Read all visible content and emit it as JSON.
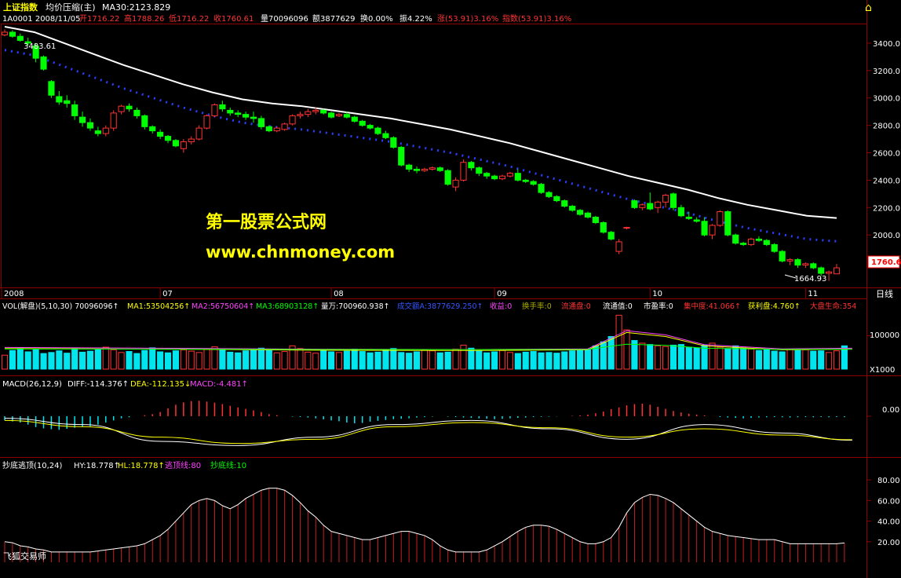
{
  "header": {
    "index_name": "上证指数",
    "main_indicator": "均价压缩(主)",
    "ma30": "MA30:2123.829",
    "quote_code_date": "1A0001 2008/11/05",
    "open": "开1716.22",
    "high": "高1788.26",
    "low": "低1716.22",
    "close": "收1760.61",
    "volume": "量70096096",
    "amount": "额3877629",
    "turnover": "换0.00%",
    "amplitude": "振4.22%",
    "change": "涨(53.91)3.16%",
    "index_change": "指数(53.91)3.16%"
  },
  "watermark": {
    "line1": "第一股票公式网",
    "line2": "www.chnmoney.com"
  },
  "annotations": {
    "high_label": "3483.61",
    "low_label": "1664.93",
    "current_price": "1760.6",
    "period": "日线"
  },
  "volume_panel": {
    "title": "VOL(解盘)(5,10,30) 70096096↑",
    "ma1": "MA1:53504256↑",
    "ma2": "MA2:56750604↑",
    "ma3": "MA3:68903128↑",
    "wan": "量万:700960.938↑",
    "amount": "成交额A:3877629.250↑",
    "yield": "收益:0",
    "turnover": "换手率:0",
    "float_shares": "流通盘:0",
    "float_value": "流通值:0",
    "pe": "市盈率:0",
    "concentration": "集中度:41.066↑",
    "profit": "获利盘:4.760↑",
    "life": "大盘生命:354",
    "axis_label": "100000",
    "unit": "X1000"
  },
  "macd_panel": {
    "title": "MACD(26,12,9)",
    "diff": "DIFF:-114.376↑",
    "dea": "DEA:-112.135↓",
    "macd": "MACD:-4.481↑",
    "axis_label": "0.00"
  },
  "bottom_panel": {
    "title": "抄底逃顶(10,24)",
    "hy": "HY:18.778↑",
    "hl": "HL:18.778↑",
    "escape": "逃顶线:80",
    "bottom": "抄底线:10",
    "brand": "飞狐交易师"
  },
  "chart_data": {
    "type": "candlestick",
    "x_ticks": [
      "2008",
      "07",
      "08",
      "09",
      "10",
      "11"
    ],
    "y_ticks": [
      3400,
      3200,
      3000,
      2800,
      2600,
      2400,
      2200,
      2000
    ],
    "ylim": [
      1640,
      3520
    ],
    "colors": {
      "up": "#ff3333",
      "down": "#00ff00",
      "ma30": "#ffffff",
      "band": "#2b3dff",
      "axis": "#8b0000"
    },
    "candles": [
      [
        3460,
        3500,
        3450,
        3480
      ],
      [
        3480,
        3495,
        3440,
        3450
      ],
      [
        3450,
        3470,
        3410,
        3420
      ],
      [
        3410,
        3440,
        3380,
        3400
      ],
      [
        3380,
        3400,
        3260,
        3290
      ],
      [
        3300,
        3310,
        3200,
        3210
      ],
      [
        3120,
        3130,
        3000,
        3020
      ],
      [
        3010,
        3050,
        2950,
        2970
      ],
      [
        2980,
        3020,
        2930,
        2960
      ],
      [
        2950,
        2980,
        2840,
        2870
      ],
      [
        2860,
        2900,
        2790,
        2820
      ],
      [
        2820,
        2850,
        2760,
        2780
      ],
      [
        2760,
        2790,
        2720,
        2740
      ],
      [
        2740,
        2800,
        2720,
        2780
      ],
      [
        2780,
        2910,
        2760,
        2890
      ],
      [
        2900,
        2950,
        2880,
        2940
      ],
      [
        2940,
        2960,
        2900,
        2920
      ],
      [
        2910,
        2930,
        2850,
        2870
      ],
      [
        2870,
        2880,
        2770,
        2790
      ],
      [
        2790,
        2800,
        2740,
        2760
      ],
      [
        2750,
        2770,
        2700,
        2720
      ],
      [
        2720,
        2730,
        2670,
        2690
      ],
      [
        2690,
        2700,
        2640,
        2650
      ],
      [
        2630,
        2700,
        2600,
        2680
      ],
      [
        2680,
        2720,
        2660,
        2700
      ],
      [
        2700,
        2800,
        2690,
        2780
      ],
      [
        2780,
        2880,
        2770,
        2870
      ],
      [
        2870,
        2960,
        2860,
        2950
      ],
      [
        2950,
        2980,
        2900,
        2920
      ],
      [
        2910,
        2930,
        2870,
        2890
      ],
      [
        2890,
        2910,
        2860,
        2880
      ],
      [
        2880,
        2900,
        2840,
        2860
      ],
      [
        2860,
        2900,
        2820,
        2850
      ],
      [
        2850,
        2870,
        2770,
        2790
      ],
      [
        2790,
        2800,
        2750,
        2760
      ],
      [
        2760,
        2790,
        2750,
        2780
      ],
      [
        2770,
        2820,
        2760,
        2810
      ],
      [
        2810,
        2880,
        2800,
        2870
      ],
      [
        2870,
        2900,
        2850,
        2880
      ],
      [
        2880,
        2920,
        2860,
        2900
      ],
      [
        2900,
        2930,
        2880,
        2910
      ],
      [
        2910,
        2920,
        2880,
        2890
      ],
      [
        2890,
        2900,
        2850,
        2860
      ],
      [
        2870,
        2890,
        2860,
        2880
      ],
      [
        2880,
        2900,
        2850,
        2860
      ],
      [
        2860,
        2870,
        2820,
        2830
      ],
      [
        2830,
        2840,
        2790,
        2800
      ],
      [
        2800,
        2810,
        2770,
        2780
      ],
      [
        2780,
        2790,
        2730,
        2740
      ],
      [
        2740,
        2760,
        2700,
        2710
      ],
      [
        2710,
        2720,
        2630,
        2640
      ],
      [
        2640,
        2650,
        2500,
        2510
      ],
      [
        2510,
        2520,
        2460,
        2480
      ],
      [
        2480,
        2500,
        2450,
        2470
      ],
      [
        2470,
        2490,
        2460,
        2480
      ],
      [
        2480,
        2500,
        2470,
        2490
      ],
      [
        2490,
        2500,
        2460,
        2470
      ],
      [
        2470,
        2480,
        2360,
        2370
      ],
      [
        2350,
        2420,
        2320,
        2400
      ],
      [
        2400,
        2550,
        2390,
        2530
      ],
      [
        2530,
        2540,
        2470,
        2490
      ],
      [
        2490,
        2500,
        2430,
        2450
      ],
      [
        2450,
        2460,
        2410,
        2430
      ],
      [
        2430,
        2440,
        2400,
        2410
      ],
      [
        2410,
        2440,
        2400,
        2430
      ],
      [
        2430,
        2460,
        2420,
        2450
      ],
      [
        2450,
        2480,
        2390,
        2400
      ],
      [
        2400,
        2410,
        2380,
        2390
      ],
      [
        2390,
        2400,
        2360,
        2370
      ],
      [
        2370,
        2380,
        2300,
        2310
      ],
      [
        2310,
        2320,
        2270,
        2280
      ],
      [
        2280,
        2290,
        2240,
        2250
      ],
      [
        2250,
        2260,
        2200,
        2210
      ],
      [
        2210,
        2220,
        2170,
        2180
      ],
      [
        2180,
        2190,
        2140,
        2150
      ],
      [
        2160,
        2170,
        2120,
        2130
      ],
      [
        2130,
        2140,
        2080,
        2090
      ],
      [
        2090,
        2100,
        2010,
        2020
      ],
      [
        2020,
        2030,
        1960,
        1970
      ],
      [
        1880,
        1970,
        1860,
        1950
      ],
      [
        2050,
        2060,
        2040,
        2055
      ],
      [
        2250,
        2260,
        2190,
        2200
      ],
      [
        2200,
        2230,
        2180,
        2220
      ],
      [
        2230,
        2310,
        2180,
        2190
      ],
      [
        2200,
        2250,
        2160,
        2240
      ],
      [
        2240,
        2300,
        2200,
        2290
      ],
      [
        2300,
        2310,
        2180,
        2200
      ],
      [
        2200,
        2220,
        2130,
        2140
      ],
      [
        2130,
        2170,
        2110,
        2120
      ],
      [
        2110,
        2130,
        2090,
        2100
      ],
      [
        2100,
        2130,
        1990,
        2000
      ],
      [
        2000,
        2080,
        1970,
        2070
      ],
      [
        2070,
        2180,
        2060,
        2170
      ],
      [
        2170,
        2180,
        1990,
        2000
      ],
      [
        2000,
        2010,
        1930,
        1940
      ],
      [
        1940,
        1950,
        1920,
        1930
      ],
      [
        1930,
        1980,
        1920,
        1970
      ],
      [
        1970,
        1990,
        1950,
        1960
      ],
      [
        1960,
        1970,
        1920,
        1930
      ],
      [
        1930,
        1940,
        1870,
        1880
      ],
      [
        1880,
        1890,
        1800,
        1810
      ],
      [
        1810,
        1830,
        1780,
        1820
      ],
      [
        1820,
        1830,
        1760,
        1780
      ],
      [
        1780,
        1800,
        1760,
        1790
      ],
      [
        1790,
        1800,
        1750,
        1760
      ],
      [
        1760,
        1770,
        1700,
        1720
      ],
      [
        1720,
        1740,
        1665,
        1730
      ],
      [
        1716,
        1788,
        1716,
        1760
      ]
    ],
    "ma30_values": [
      3520,
      3480,
      3400,
      3320,
      3240,
      3170,
      3100,
      3040,
      2990,
      2960,
      2940,
      2910,
      2880,
      2850,
      2810,
      2770,
      2720,
      2670,
      2610,
      2550,
      2490,
      2430,
      2380,
      2330,
      2270,
      2220,
      2180,
      2140,
      2123.829
    ],
    "ma30_range": [
      0,
      29
    ],
    "volume_unit": "X1000",
    "volume_ylim": [
      0,
      170000
    ],
    "volume_values": [
      42000,
      56000,
      62000,
      52000,
      58000,
      47000,
      50000,
      55000,
      48000,
      62000,
      51000,
      54000,
      60000,
      66000,
      58000,
      50000,
      53000,
      47000,
      56000,
      64000,
      52000,
      49000,
      55000,
      58000,
      54000,
      50000,
      61000,
      67000,
      58000,
      51000,
      49000,
      55000,
      60000,
      63000,
      57000,
      49000,
      53000,
      70000,
      62000,
      51000,
      48000,
      56000,
      52000,
      50000,
      54000,
      60000,
      53000,
      49000,
      51000,
      57000,
      62000,
      50000,
      48000,
      52000,
      58000,
      55000,
      49000,
      51000,
      60000,
      72000,
      63000,
      54000,
      49000,
      52000,
      56000,
      50000,
      47000,
      51000,
      53000,
      49000,
      50000,
      48000,
      52000,
      55000,
      60000,
      58000,
      70000,
      82000,
      98000,
      162000,
      118000,
      86000,
      78000,
      74000,
      70000,
      68000,
      72000,
      74000,
      66000,
      64000,
      72000,
      78000,
      66000,
      62000,
      70000,
      64000,
      60000,
      56000,
      58000,
      54000,
      52000,
      60000,
      56000,
      58000,
      54000,
      55000,
      50000,
      55000,
      70000
    ],
    "volume_ma": [
      [
        0,
        62000
      ],
      [
        20,
        60000
      ],
      [
        40,
        57000
      ],
      [
        60,
        56000
      ],
      [
        75,
        58000
      ],
      [
        80,
        110000
      ],
      [
        85,
        98000
      ],
      [
        90,
        70000
      ],
      [
        100,
        58000
      ],
      [
        109,
        60000
      ]
    ],
    "macd_ylim": [
      -180,
      120
    ],
    "macd_bars": [
      -20,
      -25,
      -30,
      -40,
      -52,
      -58,
      -62,
      -65,
      -60,
      -55,
      -52,
      -48,
      -40,
      -30,
      -20,
      -10,
      -5,
      0,
      5,
      10,
      20,
      38,
      55,
      66,
      72,
      74,
      70,
      65,
      58,
      50,
      42,
      35,
      28,
      20,
      10,
      5,
      0,
      -2,
      -4,
      -6,
      -10,
      -15,
      -20,
      -24,
      -30,
      -34,
      -32,
      -26,
      -22,
      -18,
      -14,
      -12,
      -10,
      -6,
      -4,
      -2,
      0,
      -2,
      -4,
      -6,
      -8,
      -10,
      -12,
      -14,
      -12,
      -10,
      -8,
      -6,
      -4,
      -3,
      -2,
      -1,
      0,
      2,
      4,
      8,
      14,
      22,
      34,
      42,
      52,
      58,
      60,
      55,
      45,
      35,
      25,
      18,
      12,
      8,
      4,
      0,
      -4,
      -6,
      -8,
      -10,
      -8,
      -6,
      -5,
      -4,
      -5,
      -6,
      -5,
      -4,
      -5,
      -4,
      -5,
      -4,
      -4.481
    ],
    "macd_diff": [
      [
        0,
        -10
      ],
      [
        10,
        -40
      ],
      [
        20,
        -120
      ],
      [
        30,
        -140
      ],
      [
        40,
        -100
      ],
      [
        50,
        -40
      ],
      [
        60,
        -20
      ],
      [
        70,
        -60
      ],
      [
        80,
        -110
      ],
      [
        90,
        -40
      ],
      [
        100,
        -80
      ],
      [
        109,
        -114.376
      ]
    ],
    "macd_dea": [
      [
        0,
        -20
      ],
      [
        10,
        -50
      ],
      [
        20,
        -100
      ],
      [
        30,
        -130
      ],
      [
        40,
        -110
      ],
      [
        50,
        -50
      ],
      [
        60,
        -30
      ],
      [
        70,
        -55
      ],
      [
        80,
        -100
      ],
      [
        90,
        -60
      ],
      [
        100,
        -90
      ],
      [
        109,
        -112.135
      ]
    ],
    "bottom_ylim": [
      0,
      90
    ],
    "bottom_ticks": [
      80,
      60,
      40,
      20
    ],
    "bottom_values": [
      20,
      19,
      16,
      15,
      13,
      12,
      10,
      10,
      10,
      10,
      10,
      10,
      11,
      12,
      13,
      14,
      15,
      16,
      18,
      22,
      26,
      32,
      40,
      48,
      56,
      60,
      62,
      60,
      55,
      52,
      56,
      62,
      66,
      70,
      72,
      72,
      70,
      65,
      58,
      50,
      44,
      36,
      30,
      28,
      26,
      24,
      22,
      22,
      24,
      26,
      28,
      30,
      30,
      28,
      26,
      22,
      16,
      12,
      10,
      10,
      10,
      10,
      12,
      16,
      20,
      25,
      30,
      34,
      36,
      36,
      35,
      32,
      28,
      24,
      20,
      18,
      18,
      20,
      24,
      34,
      48,
      58,
      63,
      66,
      65,
      62,
      58,
      52,
      46,
      40,
      34,
      30,
      28,
      26,
      25,
      24,
      23,
      22,
      22,
      22,
      20,
      18,
      18,
      18,
      18,
      18,
      18,
      18,
      18.778
    ]
  }
}
